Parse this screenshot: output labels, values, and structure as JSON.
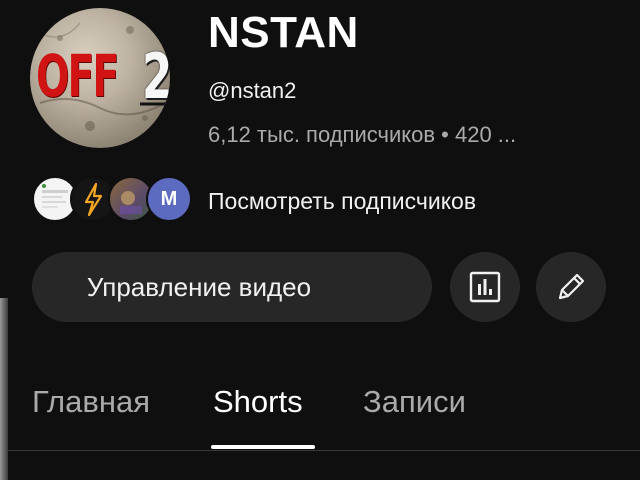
{
  "channel": {
    "avatar_text": "OFF",
    "avatar_number": "2",
    "name": "NSTAN",
    "handle": "@nstan2",
    "stats": "6,12 тыс. подписчиков • 420 ..."
  },
  "subscribers": {
    "avatars": [
      {
        "icon": "screenshot-avatar"
      },
      {
        "icon": "lightning-icon"
      },
      {
        "icon": "photo-avatar"
      },
      {
        "letter": "M"
      }
    ],
    "view_label": "Посмотреть подписчиков"
  },
  "actions": {
    "manage_videos_label": "Управление видео",
    "analytics_icon": "bar-chart-icon",
    "edit_icon": "pencil-icon"
  },
  "tabs": [
    {
      "label": "Главная",
      "active": false
    },
    {
      "label": "Shorts",
      "active": true
    },
    {
      "label": "Записи",
      "active": false
    }
  ],
  "colors": {
    "background": "#0f0f0f",
    "button_bg": "#272727",
    "secondary_text": "#aaaaaa",
    "accent_red": "#d01414",
    "avatar_purple": "#5c6bc0"
  }
}
